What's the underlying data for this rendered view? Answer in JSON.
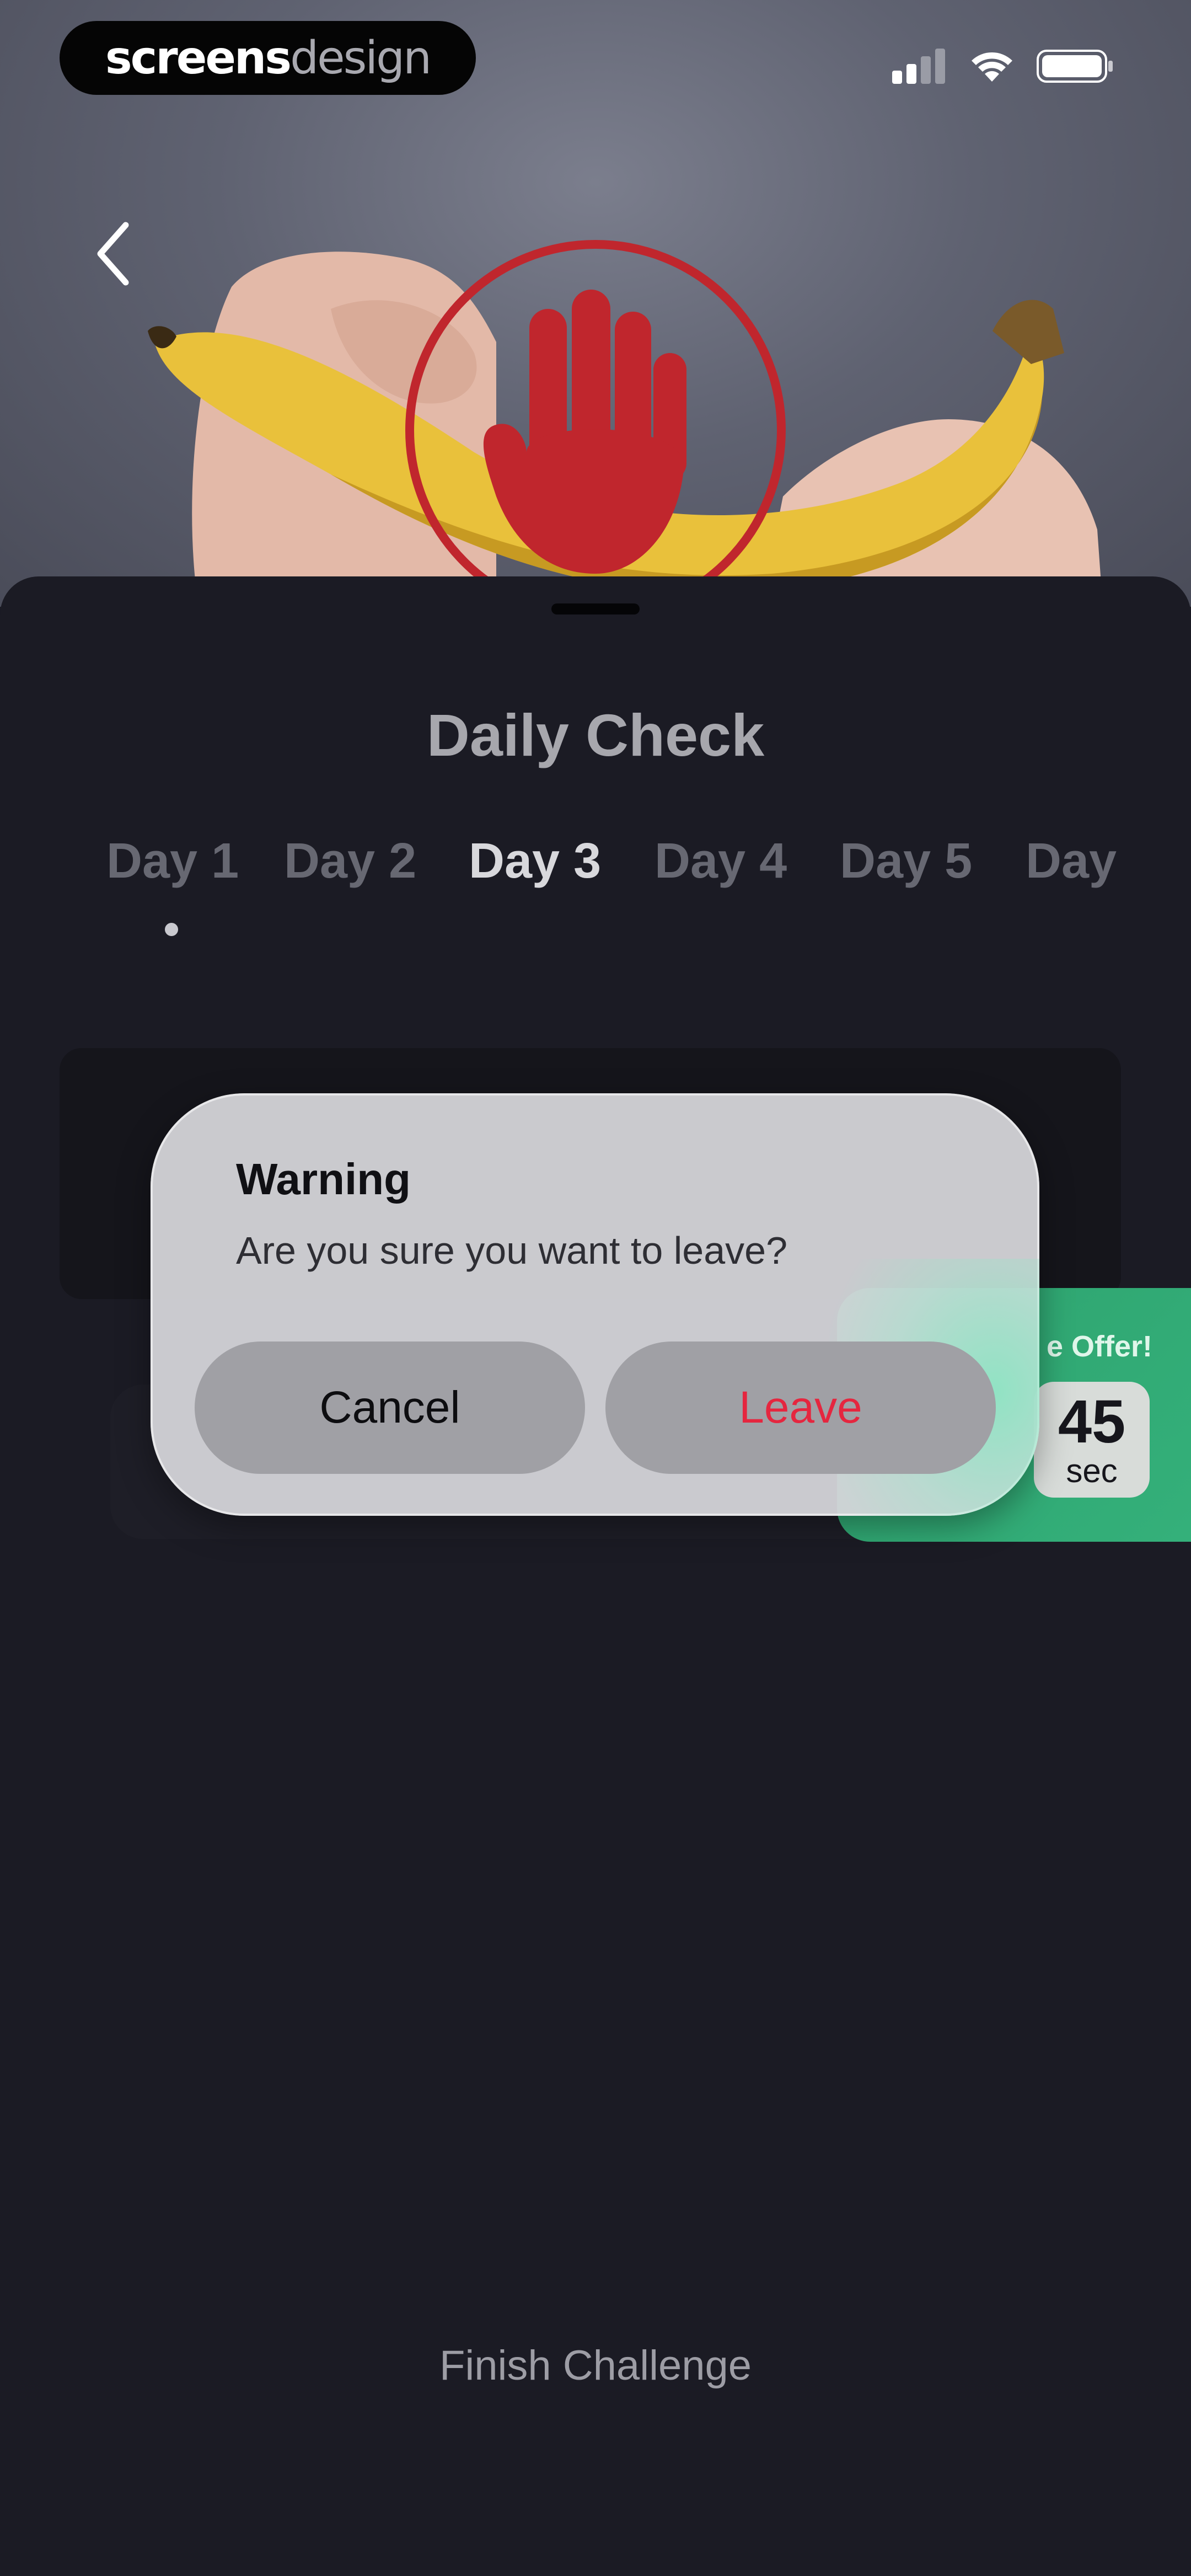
{
  "brand": {
    "part1": "screens",
    "part2": "design"
  },
  "icons": {
    "back": "chevron-left-icon",
    "signal": "cellular-signal-icon",
    "wifi": "wifi-icon",
    "battery": "battery-icon",
    "hero": "stop-hand-icon"
  },
  "colors": {
    "sheet_background": "#1b1b24",
    "accent_danger": "#e5263f",
    "offer_green": "#34b07a",
    "stop_red": "#c0262d"
  },
  "sheet": {
    "title": "Daily Check",
    "days": [
      "Day 1",
      "Day 2",
      "Day 3",
      "Day 4",
      "Day 5",
      "Day"
    ],
    "active_day_index": 2,
    "finish_label": "Finish Challenge"
  },
  "offer": {
    "label": "e Offer!",
    "seconds": "45",
    "unit": "sec"
  },
  "dialog": {
    "title": "Warning",
    "message": "Are you sure you want to leave?",
    "cancel_label": "Cancel",
    "leave_label": "Leave"
  }
}
